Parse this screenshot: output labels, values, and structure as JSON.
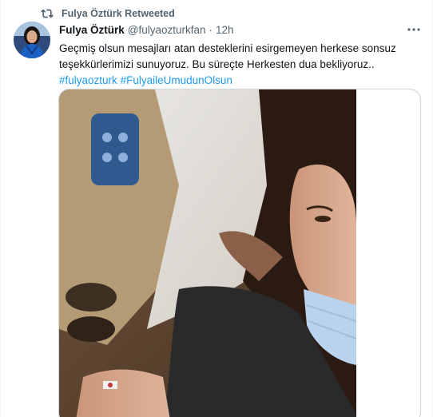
{
  "retweet": {
    "icon": "retweet-icon",
    "label": "Fulya Öztürk Retweeted"
  },
  "tweet": {
    "author": {
      "display_name": "Fulya Öztürk",
      "handle": "@fulyaozturkfan",
      "avatar_icon": "avatar"
    },
    "separator": "·",
    "timestamp": "12h",
    "more_icon": "more-icon",
    "text_lines": [
      "Geçmiş olsun mesajları atan desteklerini esirgemeyen herkese sonsuz",
      "teşekkürlerimizi sunuyoruz. Bu süreçte  Herkesten dua bekliyoruz.."
    ],
    "hashtags": [
      "#fulyaozturk",
      "#FulyaileUmudunOlsun"
    ],
    "media": {
      "type": "photo"
    }
  },
  "colors": {
    "text_primary": "#0f1419",
    "text_secondary": "#536471",
    "link": "#1d9bf0",
    "border": "#cfd9de"
  }
}
